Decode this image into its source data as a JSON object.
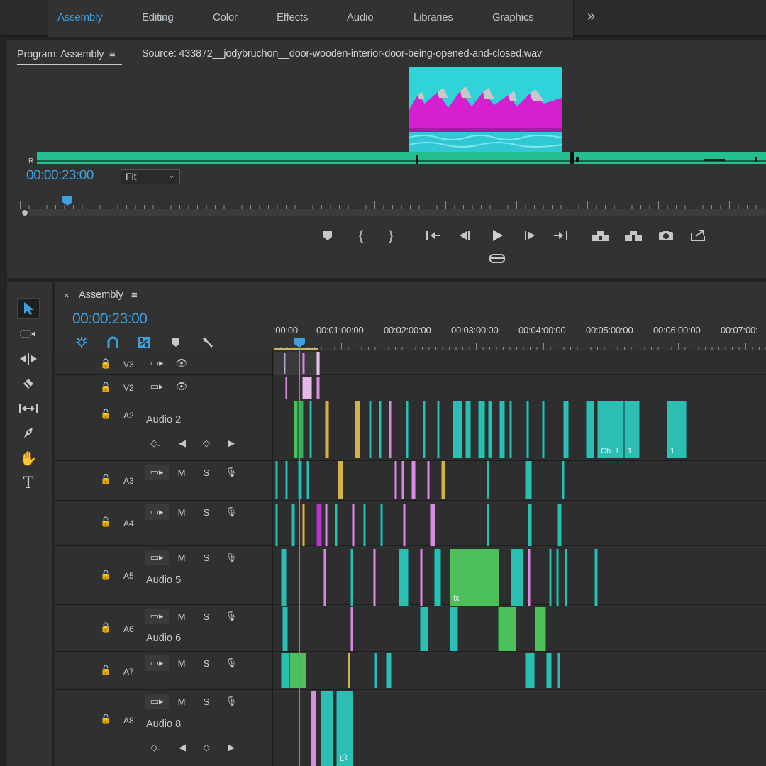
{
  "workspaces": [
    {
      "label": "Assembly",
      "active": true
    },
    {
      "label": "Editing"
    },
    {
      "label": "Color"
    },
    {
      "label": "Effects"
    },
    {
      "label": "Audio"
    },
    {
      "label": "Libraries"
    },
    {
      "label": "Graphics"
    }
  ],
  "workspace_menu_icon": "≡",
  "overflow_icon": "»",
  "program": {
    "tab_label": "Program: Assembly",
    "source_label": "Source: 433872__jodybruchon__door-wooden-interior-door-being-opened-and-closed.wav",
    "timecode": "00:00:23:00",
    "zoom": "Fit",
    "channel_label": "R",
    "scroll_position": 0.07
  },
  "transport": [
    {
      "name": "add-marker",
      "icon": "marker-icon"
    },
    {
      "name": "mark-in",
      "icon": "mark-in-icon"
    },
    {
      "name": "mark-out",
      "icon": "mark-out-icon"
    },
    {
      "name": "go-to-in",
      "icon": "go-to-in-icon"
    },
    {
      "name": "step-back",
      "icon": "step-back-icon"
    },
    {
      "name": "play",
      "icon": "play-icon"
    },
    {
      "name": "step-forward",
      "icon": "step-forward-icon"
    },
    {
      "name": "go-to-out",
      "icon": "go-to-out-icon"
    },
    {
      "name": "lift",
      "icon": "lift-icon"
    },
    {
      "name": "extract",
      "icon": "extract-icon"
    },
    {
      "name": "export-frame",
      "icon": "camera-icon"
    },
    {
      "name": "comparison-view",
      "icon": "share-icon"
    },
    {
      "name": "vr-view",
      "icon": "vr-headset-icon"
    }
  ],
  "timeline": {
    "title": "Assembly",
    "timecode": "00:00:23:00",
    "ruler_labels": [
      ":00:00",
      "00:01:00:00",
      "00:02:00:00",
      "00:03:00:00",
      "00:04:00:00",
      "00:05:00:00",
      "00:06:00:00",
      "00:07:00:"
    ],
    "tracks": [
      {
        "id": "V3",
        "type": "video"
      },
      {
        "id": "V2",
        "type": "video"
      },
      {
        "id": "A2",
        "type": "audio",
        "name": "Audio 2",
        "keyframes": true
      },
      {
        "id": "A3",
        "type": "audio"
      },
      {
        "id": "A4",
        "type": "audio"
      },
      {
        "id": "A5",
        "type": "audio",
        "name": "Audio 5"
      },
      {
        "id": "A6",
        "type": "audio",
        "name": "Audio 6"
      },
      {
        "id": "A7",
        "type": "audio"
      },
      {
        "id": "A8",
        "type": "audio",
        "name": "Audio 8",
        "keyframes": true
      }
    ],
    "mute_label": "M",
    "solo_label": "S",
    "clip_labels": [
      "Ch. 1",
      "1",
      "1",
      "fx",
      "L",
      "R"
    ]
  },
  "tools": [
    {
      "name": "selection-tool",
      "active": true
    },
    {
      "name": "track-select-tool"
    },
    {
      "name": "ripple-edit-tool"
    },
    {
      "name": "razor-tool"
    },
    {
      "name": "slip-tool"
    },
    {
      "name": "pen-tool"
    },
    {
      "name": "hand-tool"
    },
    {
      "name": "type-tool"
    }
  ],
  "colors": {
    "accent": "#3fa0e0",
    "teal_clip": "#2bbfb3",
    "green_clip": "#4cc05b",
    "pink_clip": "#d88be0",
    "yellow_clip": "#d2b34a",
    "waveform": "#23bf90"
  }
}
